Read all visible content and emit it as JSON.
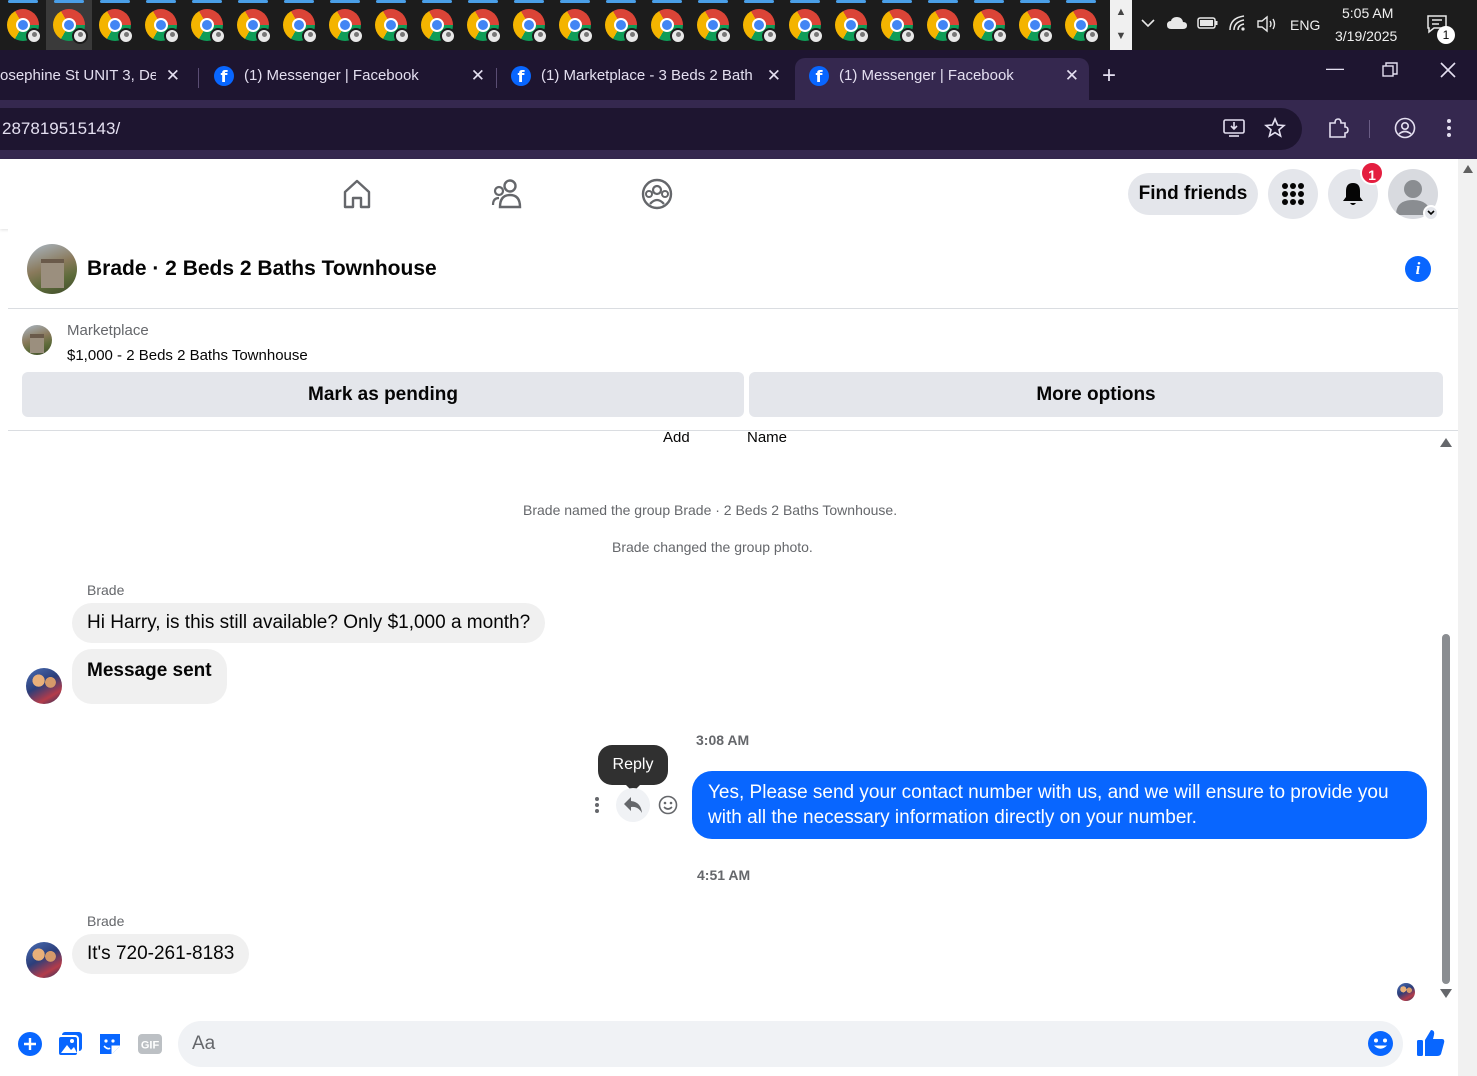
{
  "taskbar": {
    "app_count": 24,
    "active_index": 1,
    "language": "ENG",
    "time": "5:05 AM",
    "date": "3/19/2025",
    "notification_count": "1"
  },
  "browser": {
    "tabs": [
      {
        "title": "osephine St UNIT 3, De",
        "active": false
      },
      {
        "title": "(1) Messenger | Facebook",
        "active": false
      },
      {
        "title": "(1) Marketplace - 3 Beds 2 Bath",
        "active": false
      },
      {
        "title": "(1) Messenger | Facebook",
        "active": true
      }
    ],
    "url": "287819515143/"
  },
  "fb_nav": {
    "find_friends_label": "Find friends",
    "notification_count": "1"
  },
  "conversation": {
    "title": "Brade · 2 Beds 2 Baths Townhouse"
  },
  "marketplace": {
    "label": "Marketplace",
    "item": "$1,000 - 2 Beds 2 Baths Townhouse",
    "mark_pending_label": "Mark as pending",
    "more_options_label": "More options"
  },
  "thread": {
    "top_actions": [
      "Add",
      "Name"
    ],
    "system_messages": [
      "Brade named the group Brade · 2 Beds 2 Baths Townhouse.",
      "Brade changed the group photo."
    ],
    "group1": {
      "sender": "Brade",
      "messages": [
        "Hi Harry, is this still available? Only $1,000 a month?",
        "Message sent"
      ]
    },
    "timestamp1": "3:08 AM",
    "reply_tooltip": "Reply",
    "outgoing": "Yes, Please send your contact number with us, and we will ensure to provide you with all the necessary information directly on your number.",
    "timestamp2": "4:51 AM",
    "group2": {
      "sender": "Brade",
      "messages": [
        "It's 720-261-8183"
      ]
    }
  },
  "composer": {
    "placeholder": "Aa"
  },
  "colors": {
    "fb_blue": "#0866ff",
    "notif_red": "#e41e3f",
    "chrome_frame": "#1e1530",
    "chrome_toolbar": "#35284f"
  }
}
